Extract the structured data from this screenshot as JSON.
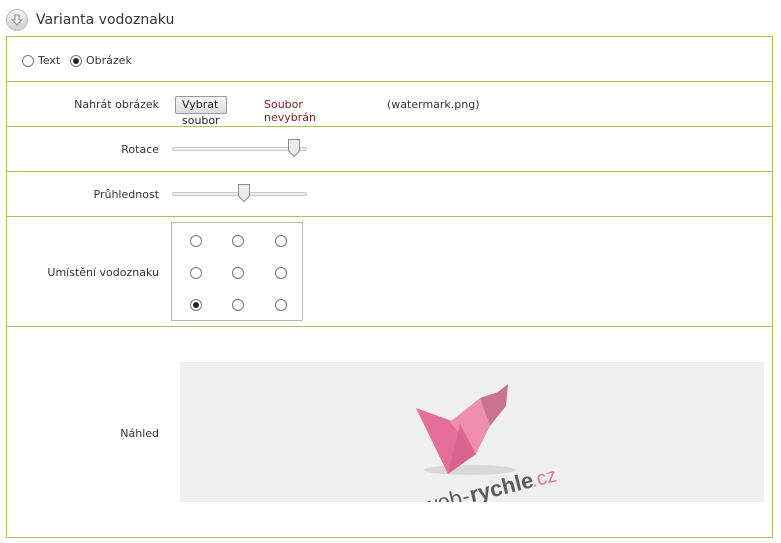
{
  "section": {
    "title": "Varianta vodoznaku",
    "icon": "chevron-down-circle-icon"
  },
  "watermark_type": {
    "options": [
      {
        "label": "Text",
        "checked": false
      },
      {
        "label": "Obrázek",
        "checked": true
      }
    ]
  },
  "upload": {
    "label": "Nahrát obrázek",
    "button_label": "Vybrat soubor",
    "status": "Soubor nevybrán",
    "current_file": "(watermark.png)"
  },
  "rotation": {
    "label": "Rotace",
    "value_fraction": 0.9
  },
  "opacity": {
    "label": "Průhlednost",
    "value_fraction": 0.53
  },
  "position": {
    "label": "Umístění vodoznaku",
    "selected": "bottom-left",
    "cells": [
      "top-left",
      "top-center",
      "top-right",
      "middle-left",
      "middle-center",
      "middle-right",
      "bottom-left",
      "bottom-center",
      "bottom-right"
    ]
  },
  "preview": {
    "label": "Náhled",
    "logo": {
      "text_web": "web",
      "text_dash": "-",
      "text_rychle": "rychle",
      "text_tld": ".cz"
    }
  },
  "colors": {
    "border": "#a8c25a",
    "logo_pink": "#e07a9d",
    "logo_text": "#555555",
    "status_text": "#7a1e1e"
  }
}
